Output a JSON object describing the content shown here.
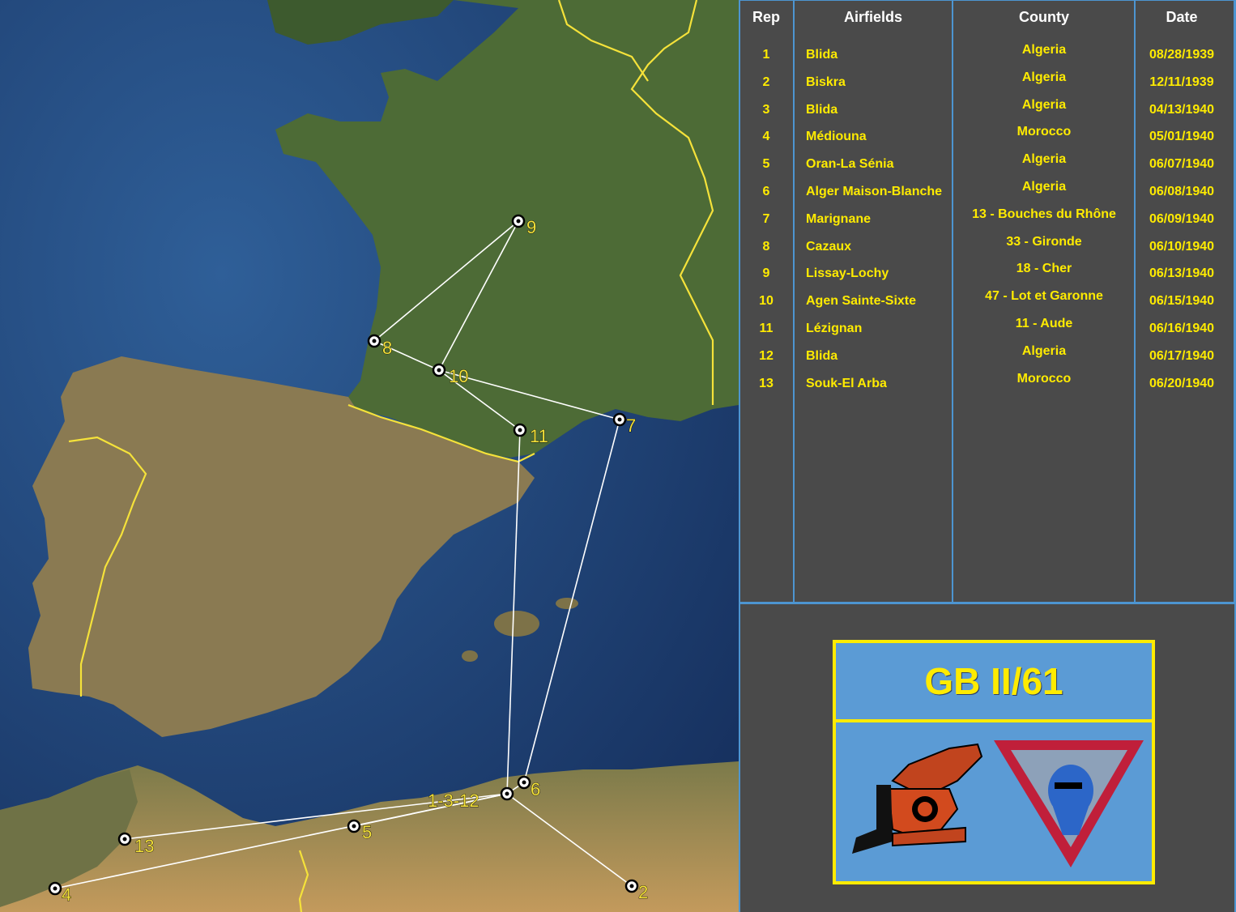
{
  "map": {
    "markers": [
      {
        "id": "1",
        "label": "1-3-12"
      },
      {
        "id": "2",
        "label": "2"
      },
      {
        "id": "4",
        "label": "4"
      },
      {
        "id": "5",
        "label": "5"
      },
      {
        "id": "6",
        "label": "6"
      },
      {
        "id": "7",
        "label": "7"
      },
      {
        "id": "8",
        "label": "8"
      },
      {
        "id": "9",
        "label": "9"
      },
      {
        "id": "10",
        "label": "10"
      },
      {
        "id": "11",
        "label": "11"
      },
      {
        "id": "13",
        "label": "13"
      }
    ],
    "colors": {
      "border": "#f5e23a",
      "route": "#ffffff",
      "label": "#f5e23a"
    }
  },
  "table": {
    "headers": {
      "rep": "Rep",
      "airfields": "Airfields",
      "county": "County",
      "date": "Date"
    },
    "rows": [
      {
        "rep": "1",
        "airfield": "Blida",
        "county": "Algeria",
        "date": "08/28/1939"
      },
      {
        "rep": "2",
        "airfield": "Biskra",
        "county": "Algeria",
        "date": "12/11/1939"
      },
      {
        "rep": "3",
        "airfield": "Blida",
        "county": "Algeria",
        "date": "04/13/1940"
      },
      {
        "rep": "4",
        "airfield": "Médiouna",
        "county": "Morocco",
        "date": "05/01/1940"
      },
      {
        "rep": "5",
        "airfield": "Oran-La Sénia",
        "county": "Algeria",
        "date": "06/07/1940"
      },
      {
        "rep": "6",
        "airfield": "Alger Maison-Blanche",
        "county": "Algeria",
        "date": "06/08/1940"
      },
      {
        "rep": "7",
        "airfield": "Marignane",
        "county": "13 - Bouches du Rhône",
        "date": "06/09/1940"
      },
      {
        "rep": "8",
        "airfield": "Cazaux",
        "county": "33 - Gironde",
        "date": "06/10/1940"
      },
      {
        "rep": "9",
        "airfield": "Lissay-Lochy",
        "county": "18 - Cher",
        "date": "06/13/1940"
      },
      {
        "rep": "10",
        "airfield": "Agen Sainte-Sixte",
        "county": "47 - Lot et Garonne",
        "date": "06/15/1940"
      },
      {
        "rep": "11",
        "airfield": "Lézignan",
        "county": "11 - Aude",
        "date": "06/16/1940"
      },
      {
        "rep": "12",
        "airfield": "Blida",
        "county": "Algeria",
        "date": "06/17/1940"
      },
      {
        "rep": "13",
        "airfield": "Souk-El Arba",
        "county": "Morocco",
        "date": "06/20/1940"
      }
    ]
  },
  "card": {
    "title": "GB II/61"
  },
  "colors": {
    "panel_bg": "#4a4a4a",
    "grid_line": "#4d95d1",
    "cell_text": "#ffeb00",
    "header_text": "#ffffff",
    "card_bg": "#5b9bd5"
  }
}
